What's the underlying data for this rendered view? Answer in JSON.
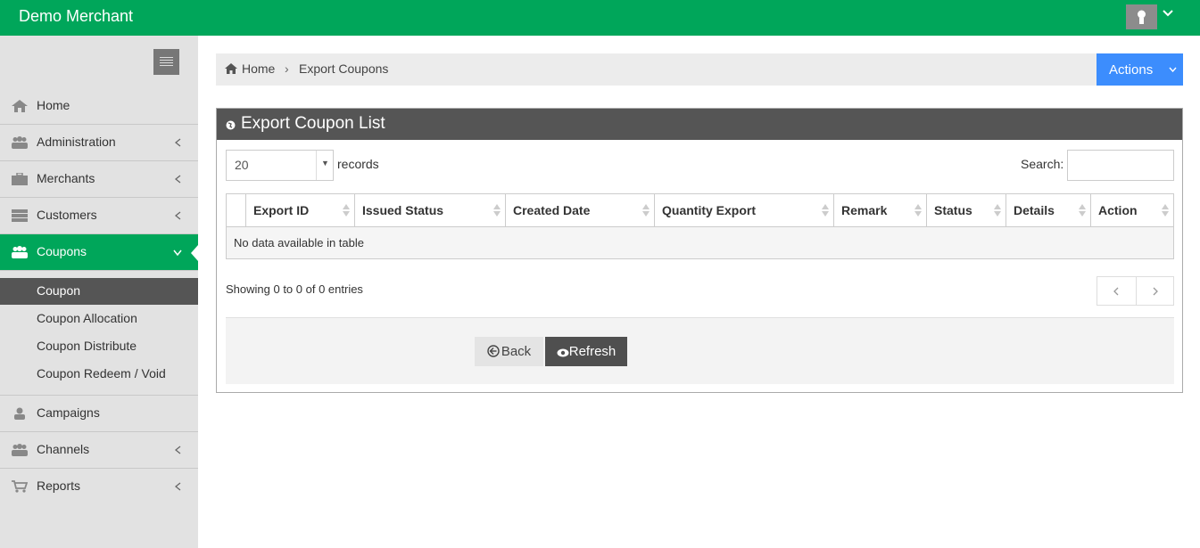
{
  "header": {
    "brand": "Demo Merchant"
  },
  "sidebar": {
    "items": [
      {
        "label": "Home"
      },
      {
        "label": "Administration"
      },
      {
        "label": "Merchants"
      },
      {
        "label": "Customers"
      },
      {
        "label": "Coupons"
      },
      {
        "label": "Campaigns"
      },
      {
        "label": "Channels"
      },
      {
        "label": "Reports"
      }
    ],
    "submenu": [
      {
        "label": "Coupon"
      },
      {
        "label": "Coupon Allocation"
      },
      {
        "label": "Coupon Distribute"
      },
      {
        "label": "Coupon Redeem / Void"
      }
    ]
  },
  "breadcrumb": {
    "home": "Home",
    "current": "Export Coupons"
  },
  "actions_label": "Actions",
  "panel": {
    "title": "Export Coupon List",
    "length_value": "20",
    "records_label": "records",
    "search_label": "Search:",
    "columns": [
      "Export ID",
      "Issued Status",
      "Created Date",
      "Quantity Export",
      "Remark",
      "Status",
      "Details",
      "Action"
    ],
    "empty_message": "No data available in table",
    "info": "Showing 0 to 0 of 0 entries",
    "back_label": "Back",
    "refresh_label": "Refresh"
  },
  "colors": {
    "primary": "#00a65a",
    "actions": "#3c8dfd",
    "panel_head": "#555555"
  }
}
